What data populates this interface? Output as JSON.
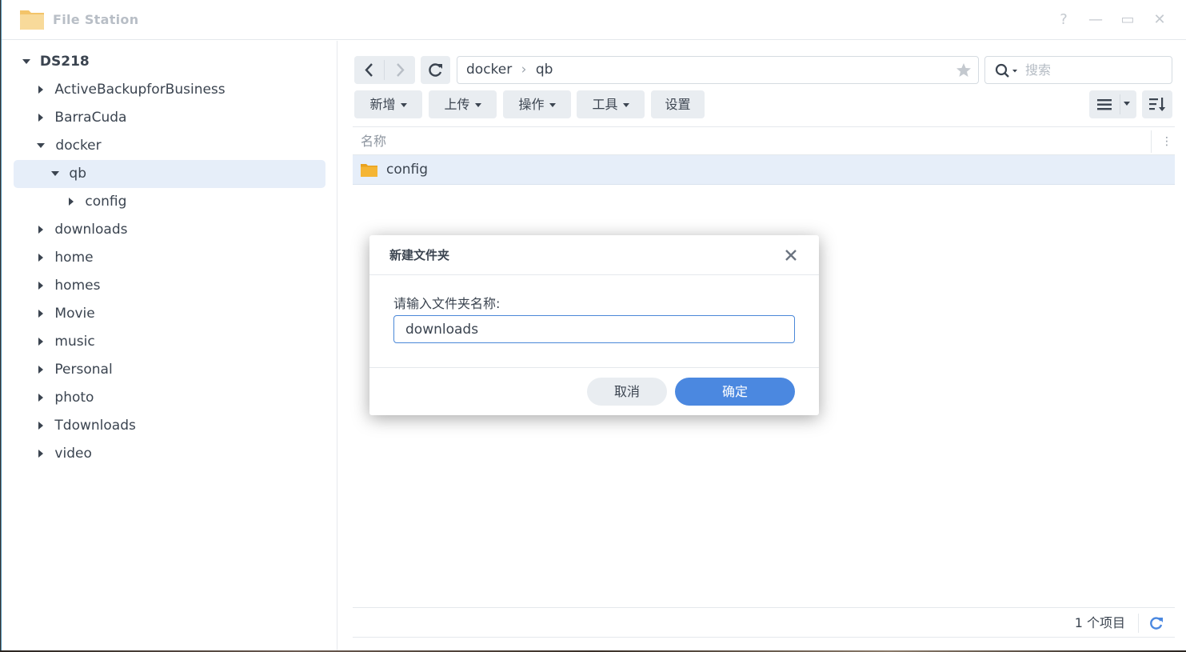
{
  "window": {
    "title": "File Station",
    "controls": [
      "?",
      "—",
      "▭",
      "✕"
    ]
  },
  "sidebar": {
    "root": "DS218",
    "items": [
      {
        "label": "ActiveBackupforBusiness",
        "level": 1,
        "expanded": false
      },
      {
        "label": "BarraCuda",
        "level": 1,
        "expanded": false
      },
      {
        "label": "docker",
        "level": 1,
        "expanded": true
      },
      {
        "label": "qb",
        "level": 2,
        "expanded": true,
        "selected": true
      },
      {
        "label": "config",
        "level": 3,
        "expanded": false
      },
      {
        "label": "downloads",
        "level": 1,
        "expanded": false
      },
      {
        "label": "home",
        "level": 1,
        "expanded": false
      },
      {
        "label": "homes",
        "level": 1,
        "expanded": false
      },
      {
        "label": "Movie",
        "level": 1,
        "expanded": false
      },
      {
        "label": "music",
        "level": 1,
        "expanded": false
      },
      {
        "label": "Personal",
        "level": 1,
        "expanded": false
      },
      {
        "label": "photo",
        "level": 1,
        "expanded": false
      },
      {
        "label": "Tdownloads",
        "level": 1,
        "expanded": false
      },
      {
        "label": "video",
        "level": 1,
        "expanded": false
      }
    ]
  },
  "path": {
    "segments": [
      "docker",
      "qb"
    ],
    "separator": "›"
  },
  "search": {
    "placeholder": "搜索"
  },
  "toolbar": {
    "new_label": "新增",
    "upload_label": "上传",
    "action_label": "操作",
    "tools_label": "工具",
    "settings_label": "设置"
  },
  "file_list": {
    "column_name": "名称",
    "rows": [
      {
        "name": "config",
        "type": "folder"
      }
    ]
  },
  "status": {
    "count_text": "1 个项目"
  },
  "dialog": {
    "title": "新建文件夹",
    "prompt": "请输入文件夹名称:",
    "input_value": "downloads",
    "cancel_label": "取消",
    "ok_label": "确定"
  },
  "colors": {
    "accent": "#4b88e0",
    "selected_bg": "#e6eef9",
    "folder": "#f5b534"
  }
}
